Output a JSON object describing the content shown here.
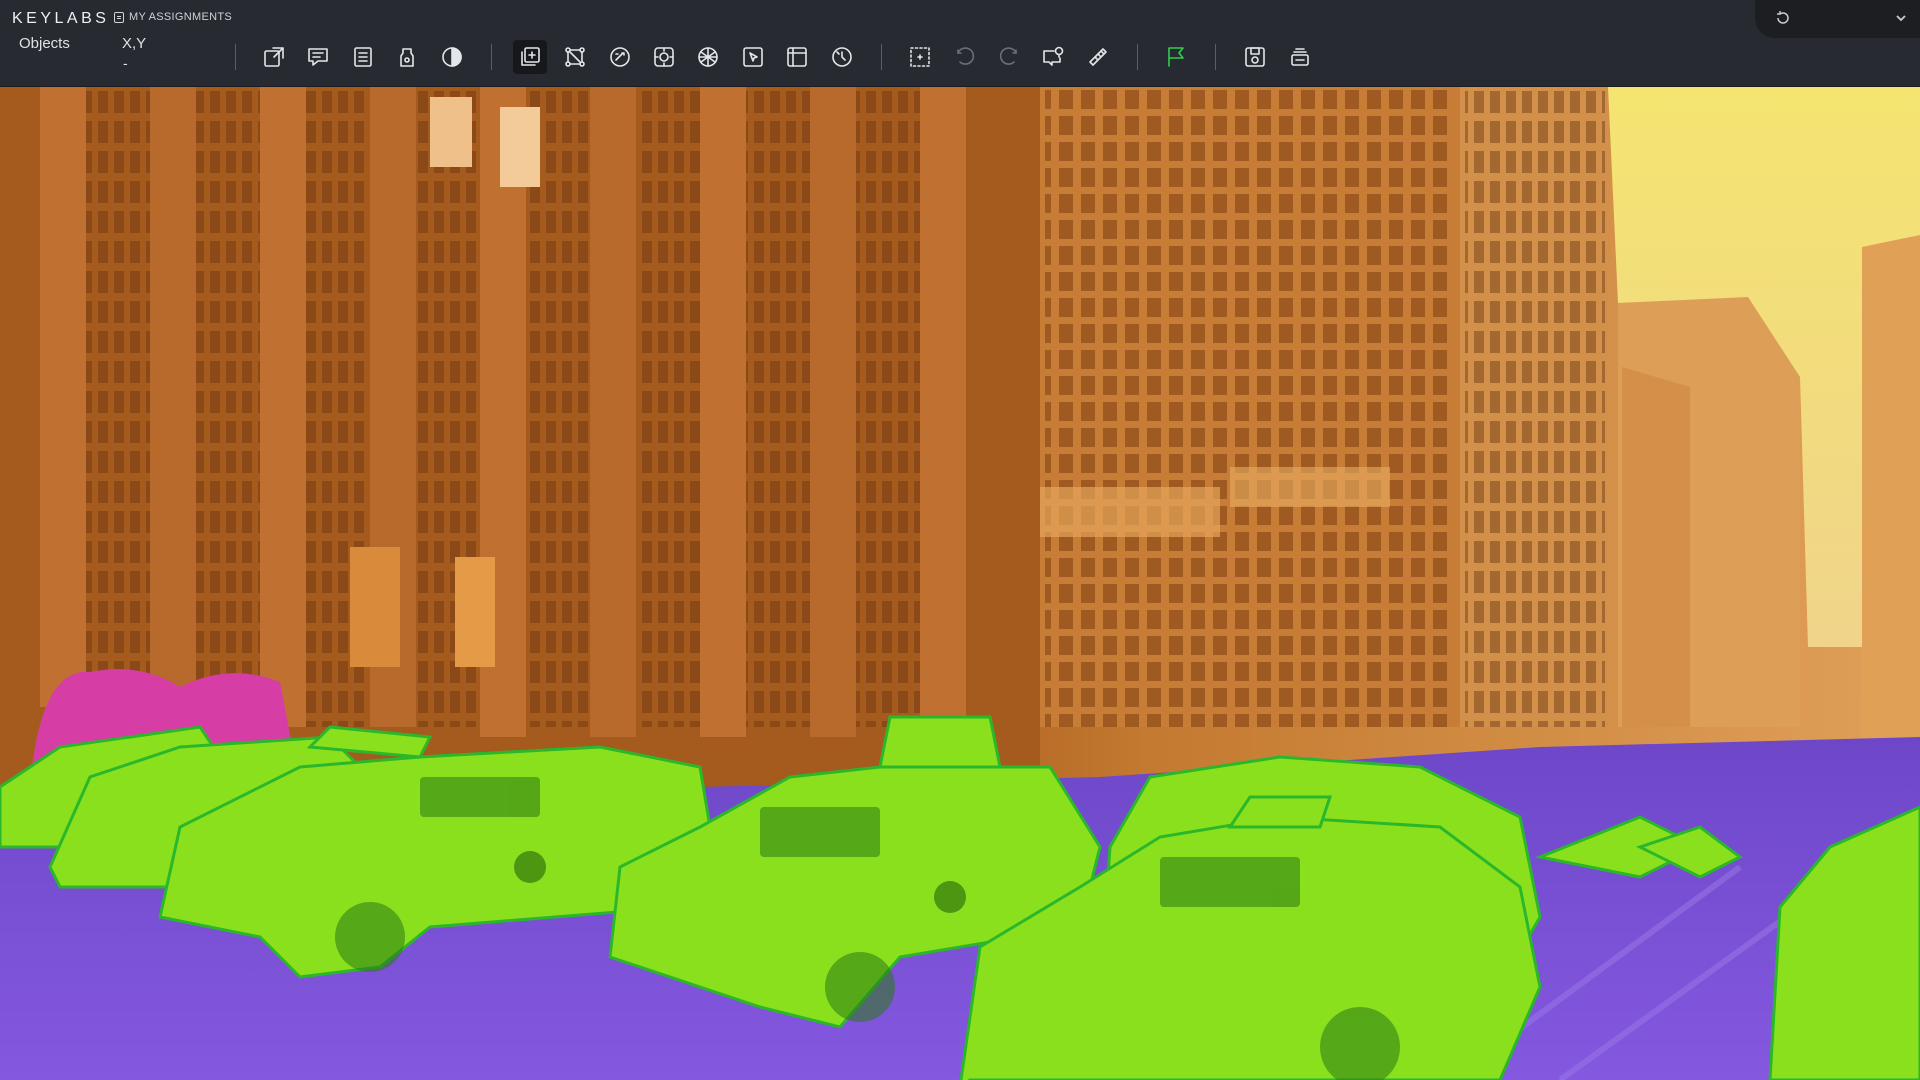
{
  "app": {
    "brand": "KEYLABS",
    "assignments_label": "MY ASSIGNMENTS"
  },
  "panel": {
    "objects_label": "Objects",
    "coords_label": "X,Y",
    "coords_value": "-"
  },
  "toolbar": {
    "tools": [
      {
        "icon": "export-icon",
        "state": "normal"
      },
      {
        "icon": "comment-icon",
        "state": "normal"
      },
      {
        "icon": "list-icon",
        "state": "normal"
      },
      {
        "icon": "marker-icon",
        "state": "normal"
      },
      {
        "icon": "contrast-icon",
        "state": "normal"
      },
      {
        "icon": "copy-frame-icon",
        "state": "active"
      },
      {
        "icon": "polygon-icon",
        "state": "normal"
      },
      {
        "icon": "magic-icon",
        "state": "normal"
      },
      {
        "icon": "segment-icon",
        "state": "normal"
      },
      {
        "icon": "mesh-icon",
        "state": "normal"
      },
      {
        "icon": "cursor-box-icon",
        "state": "normal"
      },
      {
        "icon": "grid-box-icon",
        "state": "normal"
      },
      {
        "icon": "timer-icon",
        "state": "normal"
      },
      {
        "icon": "select-icon",
        "state": "normal"
      },
      {
        "icon": "undo-icon",
        "state": "disabled"
      },
      {
        "icon": "redo-icon",
        "state": "disabled"
      },
      {
        "icon": "location-comment-icon",
        "state": "normal"
      },
      {
        "icon": "ruler-icon",
        "state": "normal"
      },
      {
        "icon": "flag-icon",
        "state": "accent"
      },
      {
        "icon": "save-icon",
        "state": "normal"
      },
      {
        "icon": "stack-icon",
        "state": "normal"
      }
    ]
  },
  "colors": {
    "toolbar_bg": "#272a30",
    "accent_flag": "#2fd04a",
    "mask_building": "#e08a2a",
    "mask_sky": "#f3e87a",
    "mask_vehicle": "#8ee01f",
    "mask_road": "#7b4fd6",
    "mask_person": "#d93fa8"
  },
  "annotation": {
    "classes": [
      "building",
      "sky",
      "vehicle",
      "road",
      "person"
    ]
  }
}
